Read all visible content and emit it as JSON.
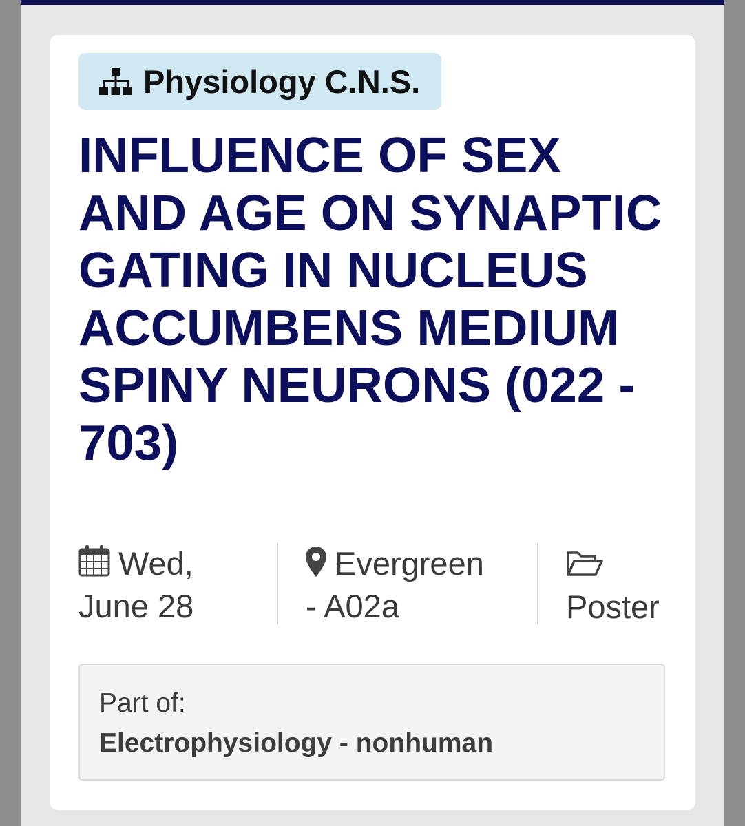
{
  "category": {
    "icon": "sitemap-icon",
    "label": "Physiology C.N.S."
  },
  "title": "INFLUENCE OF SEX AND AGE ON SYNAPTIC GATING IN NUCLEUS ACCUMBENS MEDIUM SPINY NEURONS (022 - 703)",
  "meta": {
    "date": {
      "icon": "calendar-icon",
      "line1": "Wed,",
      "line2": "June 28"
    },
    "location": {
      "icon": "map-marker-icon",
      "line1": "Evergreen",
      "line2": "- A02a"
    },
    "type": {
      "icon": "folder-open-icon",
      "label": "Poster"
    }
  },
  "part_of": {
    "label": "Part of:",
    "value": "Electrophysiology - nonhuman"
  },
  "colors": {
    "top_bar": "#0e1154",
    "title": "#0b0f5c",
    "category_pill": "#d0e8f1",
    "card": "#ffffff",
    "page_bg": "#e6e6e6"
  }
}
